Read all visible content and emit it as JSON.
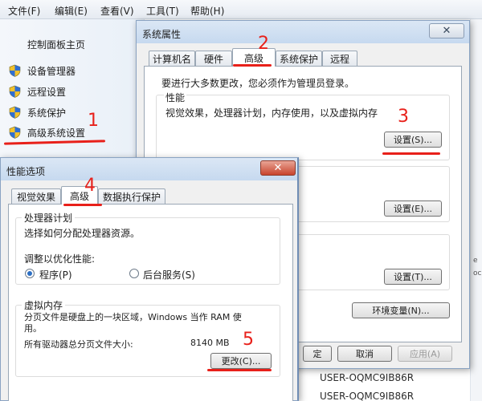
{
  "menubar": {
    "items": [
      "文件(F)",
      "编辑(E)",
      "查看(V)",
      "工具(T)",
      "帮助(H)"
    ]
  },
  "left_pane": {
    "home": "控制面板主页",
    "links": [
      "设备管理器",
      "远程设置",
      "系统保护",
      "高级系统设置"
    ]
  },
  "background": {
    "computer_name_1": "USER-OQMC9IB86R",
    "computer_name_2": "USER-OQMC9IB86R",
    "strip_fragments": [
      "e",
      "oc"
    ]
  },
  "sys_dialog": {
    "title": "系统属性",
    "tabs": [
      "计算机名",
      "硬件",
      "高级",
      "系统保护",
      "远程"
    ],
    "admin_note": "要进行大多数更改，您必须作为管理员登录。",
    "perf_label": "性能",
    "perf_desc": "视觉效果，处理器计划，内存使用，以及虚拟内存",
    "perf_settings": "设置(S)...",
    "profile_settings": "设置(E)...",
    "startup_settings": "设置(T)...",
    "env_vars": "环境变量(N)...",
    "ok": "定",
    "cancel": "取消",
    "apply": "应用(A)"
  },
  "perf_dialog": {
    "title": "性能选项",
    "tabs": [
      "视觉效果",
      "高级",
      "数据执行保护"
    ],
    "proc_group": "处理器计划",
    "proc_desc": "选择如何分配处理器资源。",
    "adjust_label": "调整以优化性能:",
    "radio_programs": "程序(P)",
    "radio_services": "后台服务(S)",
    "vm_group": "虚拟内存",
    "vm_desc_line1": "分页文件是硬盘上的一块区域，Windows 当作 RAM 使",
    "vm_desc_line2": "用。",
    "total_label": "所有驱动器总分页文件大小:",
    "total_value": "8140 MB",
    "change": "更改(C)..."
  },
  "annotations": {
    "n1": "1",
    "n2": "2",
    "n3": "3",
    "n4": "4",
    "n5": "5"
  },
  "colors": {
    "annotation": "#e8201a",
    "titlebar": "#c6d9ef",
    "close_red": "#c8442d",
    "radio_dot": "#2c6fc4"
  }
}
